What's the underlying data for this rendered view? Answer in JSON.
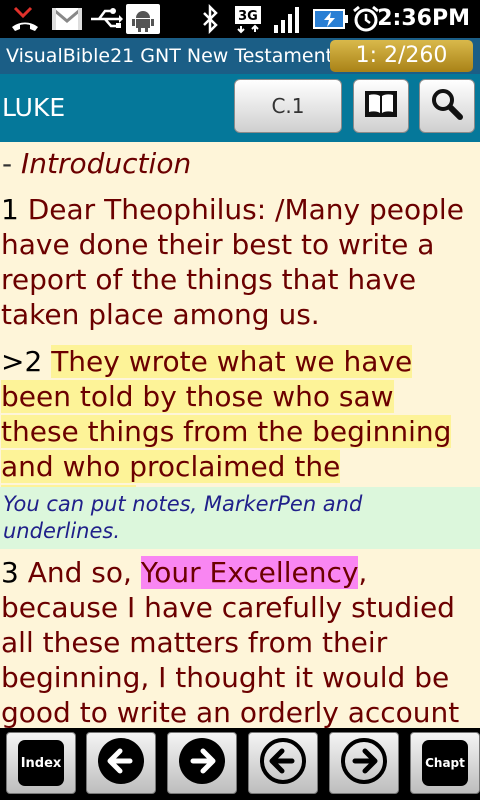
{
  "status_bar": {
    "time": "2:36PM",
    "icons": [
      "missed-call-icon",
      "gmail-icon",
      "usb-icon",
      "android-debug-icon",
      "bluetooth-icon",
      "3g-icon",
      "signal-icon",
      "battery-charging-icon",
      "alarm-icon"
    ],
    "network_label": "3G"
  },
  "header": {
    "app_title": "VisualBible21 GNT New Testament",
    "position": "1: 2/260",
    "book": "LUKE",
    "chapter_button": "C.1",
    "accent_color": "#05789a"
  },
  "content": {
    "intro_prefix": "- ",
    "intro_label": "Introduction",
    "verses": [
      {
        "number": "1",
        "text": "Dear Theophilus: /Many people have done their best to write a report of the things that have taken place among us."
      },
      {
        "marker": ">2",
        "text": "They wrote what we have been told by those who saw these things from the beginning and who proclaimed the message.",
        "highlight": "#fdf398"
      },
      {
        "number": "3",
        "highlight_part": "Your Excellency",
        "highlight": "#f986f2",
        "line_a": "And so,",
        "line_b": ",",
        "rest": "because I have carefully studied all these matters from their beginning, I thought it would be good to write an orderly account"
      }
    ],
    "note": "You can put notes, MarkerPen and underlines."
  },
  "bottom_bar": {
    "index_label": "Index",
    "chapter_label": "Chapt",
    "buttons": [
      "index-button",
      "prev-verse-button",
      "next-verse-button",
      "prev-page-button",
      "next-page-button",
      "chapter-button"
    ]
  }
}
